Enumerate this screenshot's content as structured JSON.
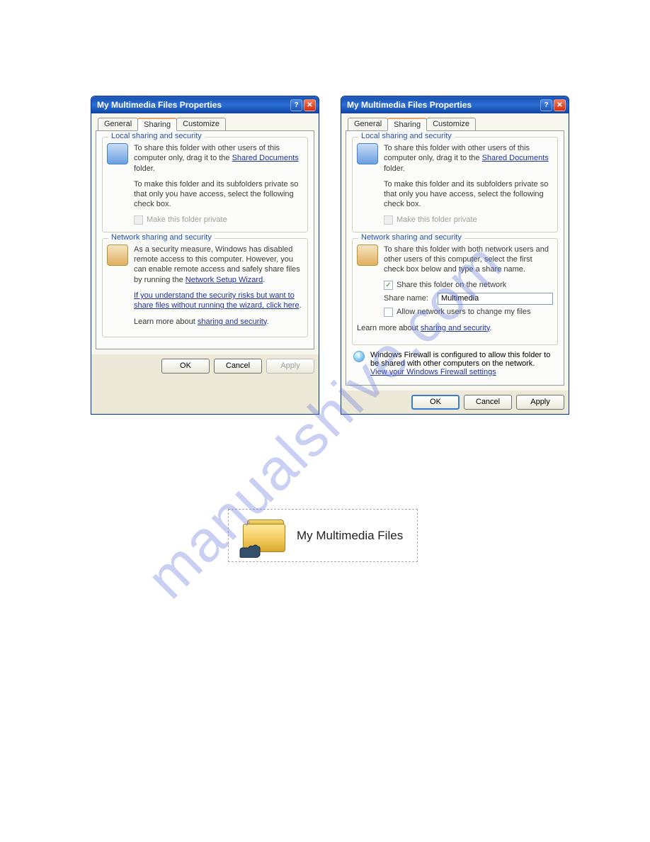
{
  "watermark": "manualshive.com",
  "dialog_left": {
    "title": "My Multimedia Files Properties",
    "tabs": [
      "General",
      "Sharing",
      "Customize"
    ],
    "active_tab": "Sharing",
    "local_group": {
      "title": "Local sharing and security",
      "line1_a": "To share this folder with other users of this computer only, drag it to the ",
      "link1": "Shared Documents",
      "line1_b": " folder.",
      "line2": "To make this folder and its subfolders private so that only you have access, select the following check box.",
      "checkbox": "Make this folder private"
    },
    "network_group": {
      "title": "Network sharing and security",
      "line1_a": "As a security measure, Windows has disabled remote access to this computer. However, you can enable remote access and safely share files by running the ",
      "link1": "Network Setup Wizard",
      "line1_b": ".",
      "link2": "If you understand the security risks but want to share files without running the wizard, click here",
      "link2_b": ".",
      "learn_a": "Learn more about ",
      "learn_link": "sharing and security",
      "learn_b": "."
    },
    "buttons": {
      "ok": "OK",
      "cancel": "Cancel",
      "apply": "Apply"
    }
  },
  "dialog_right": {
    "title": "My Multimedia Files Properties",
    "tabs": [
      "General",
      "Sharing",
      "Customize"
    ],
    "active_tab": "Sharing",
    "local_group": {
      "title": "Local sharing and security",
      "line1_a": "To share this folder with other users of this computer only, drag it to the ",
      "link1": "Shared Documents",
      "line1_b": " folder.",
      "line2": "To make this folder and its subfolders private so that only you have access, select the following check box.",
      "checkbox": "Make this folder private"
    },
    "network_group": {
      "title": "Network sharing and security",
      "line1": "To share this folder with both network users and other users of this computer, select the first check box below and type a share name.",
      "chk1": "Share this folder on the network",
      "share_label": "Share name:",
      "share_value": "Multimedia",
      "chk2": "Allow network users to change my files",
      "learn_a": "Learn more about ",
      "learn_link": "sharing and security",
      "learn_b": "."
    },
    "info": {
      "text": "Windows Firewall is configured to allow this folder to be shared with other computers on the network.",
      "link": "View your Windows Firewall settings"
    },
    "buttons": {
      "ok": "OK",
      "cancel": "Cancel",
      "apply": "Apply"
    }
  },
  "folder": {
    "label": "My Multimedia Files"
  }
}
